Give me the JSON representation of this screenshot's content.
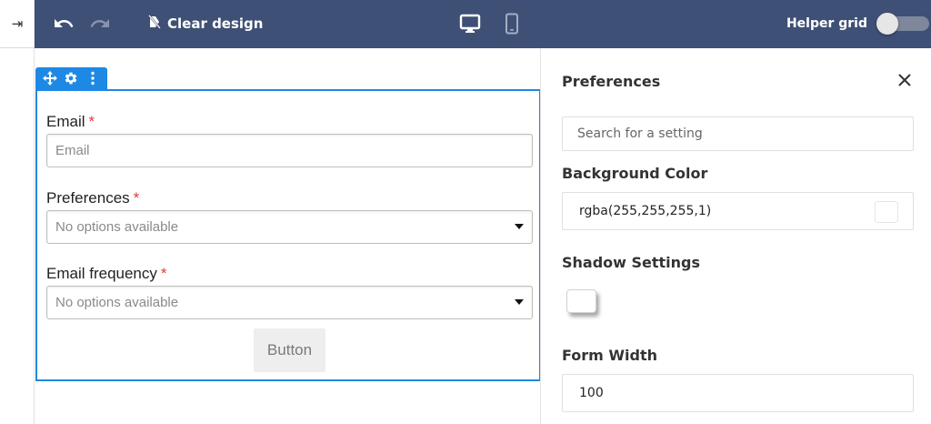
{
  "toolbar": {
    "clear_label": "Clear design",
    "helper_label": "Helper grid",
    "helper_on": false,
    "bg_color": "#3f5076"
  },
  "icons": {
    "expand": "arrow-right-to-bar-icon",
    "undo": "undo-icon",
    "redo": "redo-icon",
    "clear": "clear-design-icon",
    "desktop": "desktop-icon",
    "mobile": "mobile-icon",
    "move": "move-icon",
    "settings": "settings-gear-icon",
    "more": "more-vertical-icon",
    "close": "close-icon"
  },
  "form": {
    "accent": "#1e88e5",
    "fields": [
      {
        "label": "Email",
        "required": "*",
        "placeholder": "Email",
        "type": "text"
      },
      {
        "label": "Preferences",
        "required": "*",
        "placeholder": "No options available",
        "type": "select"
      },
      {
        "label": "Email frequency",
        "required": "*",
        "placeholder": "No options available",
        "type": "select"
      }
    ],
    "button_label": "Button"
  },
  "panel": {
    "title": "Preferences",
    "search_placeholder": "Search for a setting",
    "background_color_label": "Background Color",
    "background_color_value": "rgba(255,255,255,1)",
    "shadow_label": "Shadow Settings",
    "form_width_label": "Form Width",
    "form_width_value": "100"
  }
}
